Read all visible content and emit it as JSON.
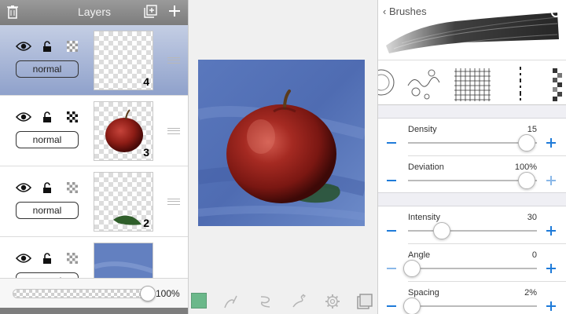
{
  "layers_panel": {
    "title": "Layers",
    "layers": [
      {
        "number": "4",
        "blend_mode": "normal",
        "selected": true,
        "content": "empty"
      },
      {
        "number": "3",
        "blend_mode": "normal",
        "selected": false,
        "content": "apple"
      },
      {
        "number": "2",
        "blend_mode": "normal",
        "selected": false,
        "content": "shadow"
      },
      {
        "number": "",
        "blend_mode": "normal",
        "selected": false,
        "content": "blue background"
      }
    ],
    "opacity_value": "100%",
    "opacity_fraction": 1.0
  },
  "canvas_panel": {
    "tools": [
      "color-swatch",
      "pen-tool",
      "smudge-tool",
      "eraser-tool",
      "settings-gear",
      "layers-tool"
    ],
    "swatch_color": "#6bb88a"
  },
  "brushes_panel": {
    "back_label": "Brushes",
    "params": [
      {
        "label": "Density",
        "value": "15",
        "fraction": 0.92
      },
      {
        "label": "Deviation",
        "value": "100%",
        "fraction": 0.92
      },
      {
        "label": "Intensity",
        "value": "30",
        "fraction": 0.26
      },
      {
        "label": "Angle",
        "value": "0",
        "fraction": 0.03
      },
      {
        "label": "Spacing",
        "value": "2%",
        "fraction": 0.03
      }
    ],
    "accent_color": "#1f7bd9"
  }
}
